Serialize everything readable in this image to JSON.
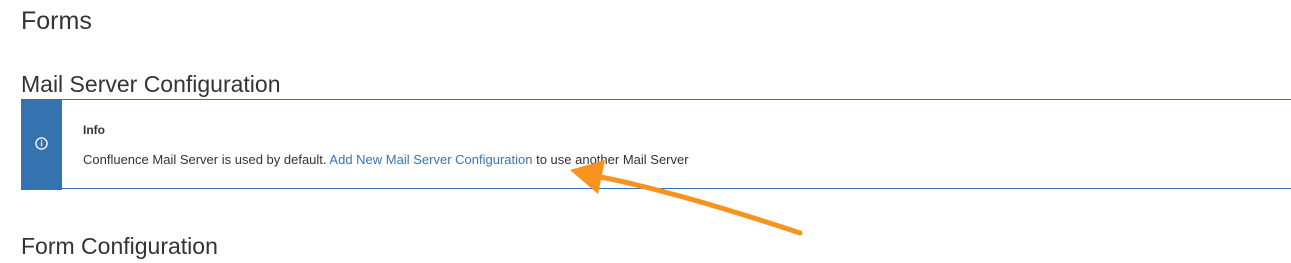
{
  "page": {
    "title": "Forms"
  },
  "mail_section": {
    "title": "Mail Server Configuration",
    "info": {
      "icon": "info-icon",
      "heading": "Info",
      "text_before": "Confluence Mail Server is used by default.",
      "link_label": "Add New Mail Server Configuration",
      "text_after": "to use another Mail Server"
    }
  },
  "form_section": {
    "title": "Form Configuration"
  },
  "colors": {
    "accent": "#3572b0",
    "link": "#3b73af",
    "annotation_arrow": "#f7931e"
  }
}
